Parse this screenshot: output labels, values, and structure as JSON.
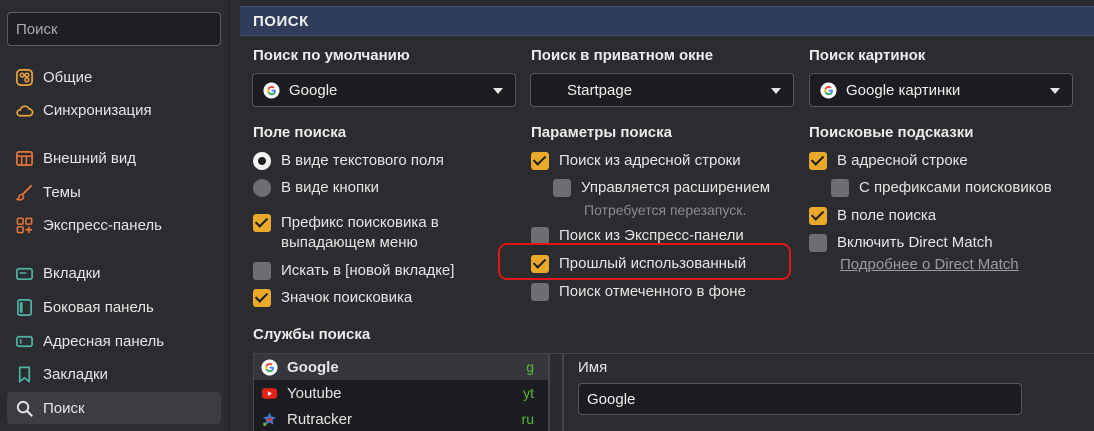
{
  "sidebar": {
    "search_placeholder": "Поиск",
    "items": [
      {
        "label": "Общие",
        "icon": "general-icon"
      },
      {
        "label": "Синхронизация",
        "icon": "cloud-icon"
      },
      {
        "label": "Внешний вид",
        "icon": "appearance-icon"
      },
      {
        "label": "Темы",
        "icon": "brush-icon"
      },
      {
        "label": "Экспресс-панель",
        "icon": "speed-dial-icon"
      },
      {
        "label": "Вкладки",
        "icon": "tabs-icon"
      },
      {
        "label": "Боковая панель",
        "icon": "side-panel-icon"
      },
      {
        "label": "Адресная панель",
        "icon": "address-bar-icon"
      },
      {
        "label": "Закладки",
        "icon": "bookmark-icon"
      },
      {
        "label": "Поиск",
        "icon": "search-icon",
        "active": true
      }
    ]
  },
  "main": {
    "header": "ПОИСК",
    "default_search": {
      "title": "Поиск по умолчанию",
      "value": "Google"
    },
    "private_search": {
      "title": "Поиск в приватном окне",
      "value": "Startpage"
    },
    "image_search": {
      "title": "Поиск картинок",
      "value": "Google картинки"
    },
    "search_field": {
      "title": "Поле поиска",
      "radio_text_field": "В виде текстового поля",
      "radio_button": "В виде кнопки",
      "prefix_dropdown_line1": "Префикс поисковика в",
      "prefix_dropdown_line2": "выпадающем меню",
      "search_new_tab": "Искать в [новой вкладке]",
      "engine_icon": "Значок поисковика"
    },
    "search_params": {
      "title": "Параметры поиска",
      "from_address_bar": "Поиск из адресной строки",
      "managed_by_extension": "Управляется расширением",
      "restart_hint": "Потребуется перезапуск.",
      "from_speed_dial": "Поиск из Экспресс-панели",
      "last_used": "Прошлый использованный",
      "selected_background": "Поиск отмеченного в фоне"
    },
    "suggestions": {
      "title": "Поисковые подсказки",
      "in_address_bar": "В адресной строке",
      "with_prefixes": "С префиксами поисковиков",
      "in_search_field": "В поле поиска",
      "direct_match": "Включить Direct Match",
      "direct_match_link": "Подробнее о Direct Match"
    },
    "services": {
      "title": "Службы поиска",
      "items": [
        {
          "name": "Google",
          "key": "g",
          "active": true
        },
        {
          "name": "Youtube",
          "key": "yt"
        },
        {
          "name": "Rutracker",
          "key": "ru"
        }
      ]
    },
    "detail": {
      "name_label": "Имя",
      "name_value": "Google"
    }
  },
  "colors": {
    "accent_checkbox": "#e9a92b",
    "header_bg": "#2f3c5a",
    "highlight_ring": "#e0161c",
    "service_key": "#5fb53b"
  }
}
